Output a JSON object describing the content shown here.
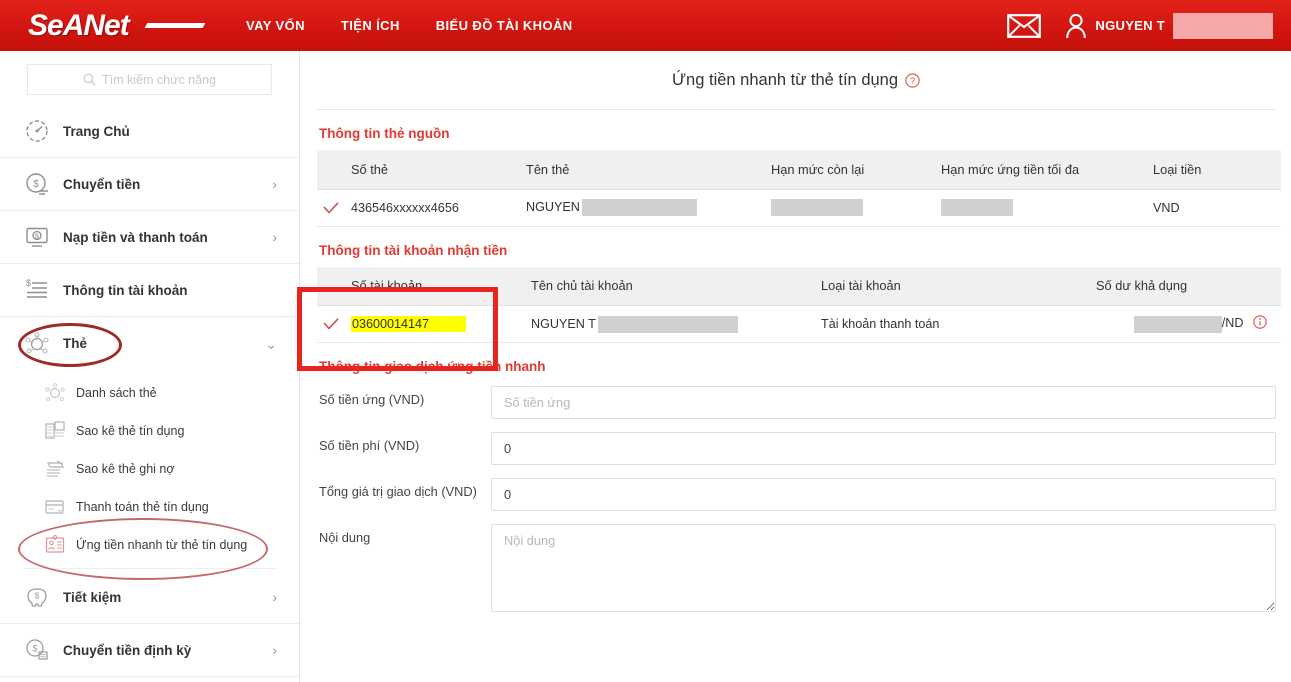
{
  "header": {
    "logo_text": "SeANet",
    "nav": [
      {
        "label": "VAY VỐN"
      },
      {
        "label": "TIỆN ÍCH"
      },
      {
        "label": "BIỂU ĐỒ TÀI KHOẢN"
      }
    ],
    "mail_icon": "envelope-icon",
    "user_icon": "user-icon",
    "user_name": "NGUYEN T",
    "brand_color": "#e2231a"
  },
  "sidebar": {
    "search_placeholder": "Tìm kiếm chức năng",
    "search_icon": "search-icon",
    "items": [
      {
        "label": "Trang Chủ",
        "icon": "dashboard-icon",
        "chevron": ""
      },
      {
        "label": "Chuyển tiền",
        "icon": "transfer-money-icon",
        "chevron": "›"
      },
      {
        "label": "Nạp tiền và thanh toán",
        "icon": "top-up-icon",
        "chevron": "›"
      },
      {
        "label": "Thông tin tài khoản",
        "icon": "account-info-icon",
        "chevron": ""
      },
      {
        "label": "Thẻ",
        "icon": "card-icon",
        "chevron": "⌄"
      }
    ],
    "submenu": [
      {
        "label": "Danh sách thẻ",
        "icon": "card-list-icon"
      },
      {
        "label": "Sao kê thẻ tín dụng",
        "icon": "credit-statement-icon"
      },
      {
        "label": "Sao kê thẻ ghi nợ",
        "icon": "debit-statement-icon"
      },
      {
        "label": "Thanh toán thẻ tín dụng",
        "icon": "card-payment-icon"
      },
      {
        "label": "Ứng tiền nhanh từ thẻ tín dụng",
        "icon": "cash-advance-icon"
      }
    ],
    "items_after": [
      {
        "label": "Tiết kiệm",
        "icon": "savings-icon",
        "chevron": "›"
      },
      {
        "label": "Chuyển tiền định kỳ",
        "icon": "recurring-transfer-icon",
        "chevron": "›"
      }
    ]
  },
  "main": {
    "page_title": "Ứng tiền nhanh từ thẻ tín dụng",
    "help_icon": "question-mark-icon",
    "source_card": {
      "section_title": "Thông tin thẻ nguồn",
      "columns": [
        "Số thẻ",
        "Tên thẻ",
        "Hạn mức còn lại",
        "Hạn mức ứng tiền tối đa",
        "Loại tiền"
      ],
      "rows": [
        {
          "checked": true,
          "card_number": "436546xxxxxx4656",
          "card_name": "NGUYEN",
          "card_name_redacted": true,
          "remaining_limit": "",
          "remaining_limit_redacted": true,
          "max_advance": "",
          "max_advance_redacted": true,
          "currency": "VND"
        }
      ]
    },
    "dest_account": {
      "section_title": "Thông tin tài khoản nhận tiền",
      "columns": [
        "Số tài khoản",
        "Tên chủ tài khoản",
        "Loại tài khoản",
        "Số dư khả dụng"
      ],
      "rows": [
        {
          "checked": true,
          "account_number": "03600014147",
          "account_number_highlighted": true,
          "owner_name": "NGUYEN T",
          "owner_name_redacted": true,
          "account_type": "Tài khoản thanh toán",
          "balance_suffix": "/ND",
          "balance_redacted": true,
          "info_icon": "info-circle-icon"
        }
      ]
    },
    "transaction": {
      "section_title": "Thông tin giao dịch ứng tiền nhanh",
      "fields": [
        {
          "label": "Số tiền ứng (VND)",
          "value": "",
          "placeholder": "Số tiền ứng",
          "type": "input"
        },
        {
          "label": "Số tiền phí (VND)",
          "value": "0",
          "placeholder": "",
          "type": "input"
        },
        {
          "label": "Tổng giá trị giao dịch (VND)",
          "value": "0",
          "placeholder": "",
          "type": "input"
        },
        {
          "label": "Nội dung",
          "value": "",
          "placeholder": "Nội dung",
          "type": "textarea"
        }
      ]
    }
  },
  "annotations": {
    "highlight_color": "#ffff00",
    "box_color": "#e8241c",
    "ellipse_color": "#9e2b25"
  }
}
